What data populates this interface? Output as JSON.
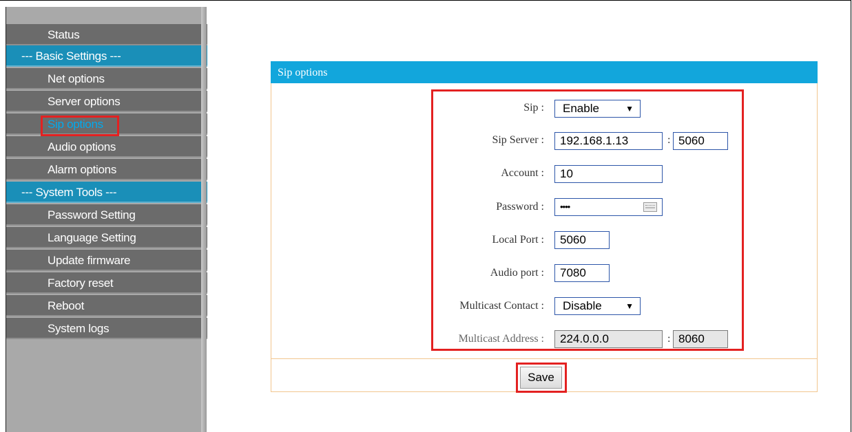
{
  "sidebar": {
    "items": [
      {
        "label": "Status",
        "kind": "item"
      },
      {
        "label": "--- Basic Settings ---",
        "kind": "section"
      },
      {
        "label": "Net options",
        "kind": "item"
      },
      {
        "label": "Server options",
        "kind": "item"
      },
      {
        "label": "Sip options",
        "kind": "item",
        "active": true
      },
      {
        "label": "Audio options",
        "kind": "item"
      },
      {
        "label": "Alarm options",
        "kind": "item"
      },
      {
        "label": "--- System Tools ---",
        "kind": "section"
      },
      {
        "label": "Password Setting",
        "kind": "item"
      },
      {
        "label": "Language Setting",
        "kind": "item"
      },
      {
        "label": "Update firmware",
        "kind": "item"
      },
      {
        "label": "Factory reset",
        "kind": "item"
      },
      {
        "label": "Reboot",
        "kind": "item"
      },
      {
        "label": "System logs",
        "kind": "item"
      }
    ]
  },
  "panel": {
    "title": "Sip options"
  },
  "form": {
    "sip": {
      "label": "Sip :",
      "value": "Enable"
    },
    "sip_server": {
      "label": "Sip Server :",
      "address": "192.168.1.13",
      "port": "5060"
    },
    "account": {
      "label": "Account :",
      "value": "10"
    },
    "password": {
      "label": "Password :",
      "value": "••••"
    },
    "local_port": {
      "label": "Local Port :",
      "value": "5060"
    },
    "audio_port": {
      "label": "Audio port :",
      "value": "7080"
    },
    "multicast_contact": {
      "label": "Multicast Contact :",
      "value": "Disable"
    },
    "multicast_address": {
      "label": "Multicast Address :",
      "address": "224.0.0.0",
      "port": "8060"
    },
    "separator": ":"
  },
  "save": {
    "label": "Save"
  },
  "colors": {
    "sidebar_item_bg": "#6b6b6b",
    "sidebar_section_bg": "#1a8fb8",
    "active_text": "#00aaee",
    "panel_header_bg": "#12a6dc",
    "panel_border": "#f2c68e",
    "highlight_border": "#e32121"
  },
  "icons": {
    "select_arrow": "▼",
    "password_keyboard": "keyboard-icon"
  }
}
